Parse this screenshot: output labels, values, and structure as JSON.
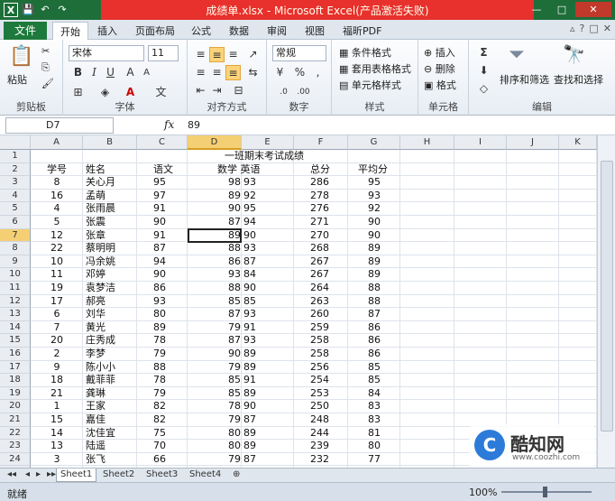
{
  "window": {
    "title": "成绩单.xlsx - Microsoft Excel(产品激活失败)",
    "minimize": "—",
    "maximize": "□",
    "close": "✕"
  },
  "tabs": [
    "文件",
    "开始",
    "插入",
    "页面布局",
    "公式",
    "数据",
    "审阅",
    "视图",
    "福昕PDF"
  ],
  "ribbon": {
    "clipboard": {
      "label": "剪贴板",
      "paste": "粘贴"
    },
    "font": {
      "label": "字体",
      "name": "宋体",
      "size": "11"
    },
    "alignment": {
      "label": "对齐方式"
    },
    "number": {
      "label": "数字",
      "format": "常规"
    },
    "styles": {
      "label": "样式",
      "conditional": "条件格式",
      "table": "套用表格格式",
      "cell": "单元格样式"
    },
    "cells": {
      "label": "单元格",
      "insert": "插入",
      "delete": "删除",
      "format": "格式"
    },
    "editing": {
      "label": "编辑",
      "sort": "排序和筛选",
      "find": "查找和选择"
    }
  },
  "formula_bar": {
    "name_box": "D7",
    "fx": "fx",
    "value": "89"
  },
  "sheet": {
    "columns": [
      "A",
      "B",
      "C",
      "D",
      "E",
      "F",
      "G",
      "H",
      "I",
      "J",
      "K"
    ],
    "title": "一班期末考试成绩",
    "headers": {
      "id": "学号",
      "name": "姓名",
      "chinese": "语文",
      "math_english": "数学 英语",
      "total": "总分",
      "avg": "平均分"
    },
    "rows": [
      [
        "8",
        "关心月",
        "95",
        "98",
        "93",
        "286",
        "95"
      ],
      [
        "16",
        "孟萌",
        "97",
        "89",
        "92",
        "278",
        "93"
      ],
      [
        "4",
        "张雨晨",
        "91",
        "90",
        "95",
        "276",
        "92"
      ],
      [
        "5",
        "张震",
        "90",
        "87",
        "94",
        "271",
        "90"
      ],
      [
        "12",
        "张章",
        "91",
        "89",
        "90",
        "270",
        "90"
      ],
      [
        "22",
        "蔡明明",
        "87",
        "88",
        "93",
        "268",
        "89"
      ],
      [
        "10",
        "冯余姚",
        "94",
        "86",
        "87",
        "267",
        "89"
      ],
      [
        "11",
        "邓婷",
        "90",
        "93",
        "84",
        "267",
        "89"
      ],
      [
        "19",
        "袁梦洁",
        "86",
        "88",
        "90",
        "264",
        "88"
      ],
      [
        "17",
        "郝亮",
        "93",
        "85",
        "85",
        "263",
        "88"
      ],
      [
        "6",
        "刘华",
        "80",
        "87",
        "93",
        "260",
        "87"
      ],
      [
        "7",
        "黄光",
        "89",
        "79",
        "91",
        "259",
        "86"
      ],
      [
        "20",
        "庄秀成",
        "78",
        "87",
        "93",
        "258",
        "86"
      ],
      [
        "2",
        "李梦",
        "79",
        "90",
        "89",
        "258",
        "86"
      ],
      [
        "9",
        "陈小小",
        "88",
        "79",
        "89",
        "256",
        "85"
      ],
      [
        "18",
        "戴菲菲",
        "78",
        "85",
        "91",
        "254",
        "85"
      ],
      [
        "21",
        "龚琳",
        "79",
        "85",
        "89",
        "253",
        "84"
      ],
      [
        "1",
        "王家",
        "82",
        "78",
        "90",
        "250",
        "83"
      ],
      [
        "15",
        "嘉佳",
        "82",
        "79",
        "87",
        "248",
        "83"
      ],
      [
        "14",
        "沈佳宜",
        "75",
        "80",
        "89",
        "244",
        "81"
      ],
      [
        "13",
        "陆遥",
        "70",
        "80",
        "89",
        "239",
        "80"
      ],
      [
        "3",
        "张飞",
        "66",
        "79",
        "87",
        "232",
        "77"
      ]
    ],
    "selected_cell": "D7"
  },
  "sheet_tabs": [
    "Sheet1",
    "Sheet2",
    "Sheet3",
    "Sheet4"
  ],
  "status": {
    "ready": "就绪",
    "zoom": "100%"
  },
  "watermark": {
    "name": "酷知网",
    "url": "www.coozhi.com"
  }
}
